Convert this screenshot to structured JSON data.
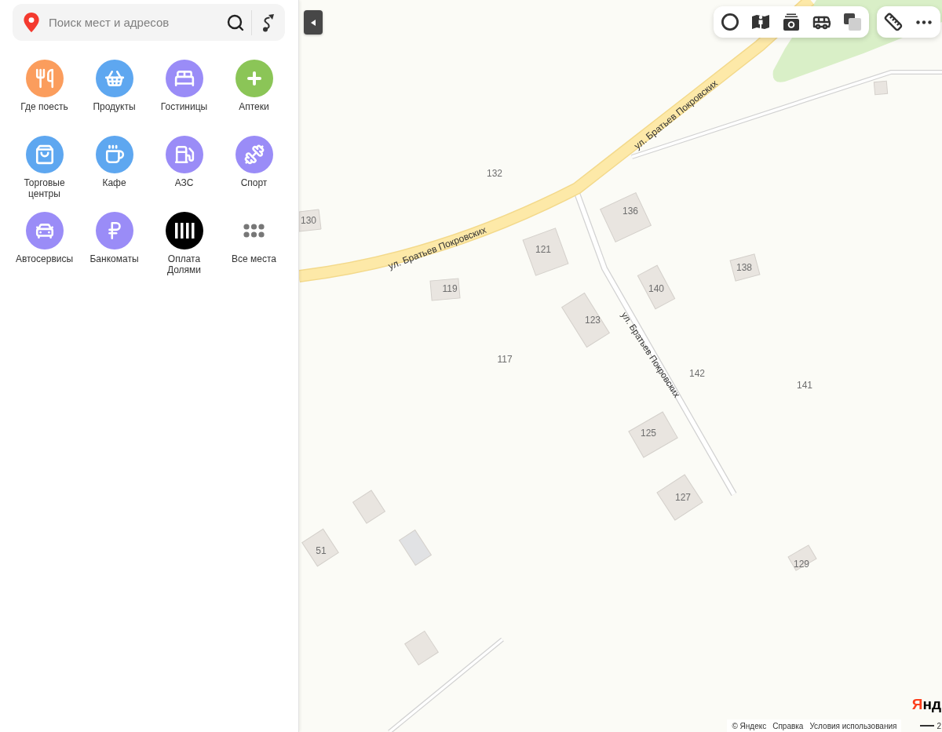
{
  "search": {
    "placeholder": "Поиск мест и адресов"
  },
  "categories": [
    {
      "label": "Где поесть",
      "kind": "category",
      "color": "#fb9d5d"
    },
    {
      "label": "Продукты",
      "kind": "category",
      "color": "#5ea7f0"
    },
    {
      "label": "Гостиницы",
      "kind": "category",
      "color": "#9a8cf7"
    },
    {
      "label": "Аптеки",
      "kind": "category",
      "color": "#8bc557"
    },
    {
      "label": "Торговые центры",
      "kind": "category",
      "color": "#5ea7f0"
    },
    {
      "label": "Кафе",
      "kind": "category",
      "color": "#5ea7f0"
    },
    {
      "label": "АЗС",
      "kind": "category",
      "color": "#9a8cf7"
    },
    {
      "label": "Спорт",
      "kind": "category",
      "color": "#9a8cf7"
    },
    {
      "label": "Автосервисы",
      "kind": "category",
      "color": "#9a8cf7"
    },
    {
      "label": "Банкоматы",
      "kind": "category",
      "color": "#9a8cf7"
    },
    {
      "label": "Оплата Долями",
      "kind": "category",
      "color": "#000000"
    },
    {
      "label": "Все места",
      "kind": "more"
    }
  ],
  "map": {
    "street_labels": [
      "ул. Братьев Покровских",
      "ул. Братьев Покровских",
      "ул. Братьев Покровских"
    ],
    "house_numbers": [
      "132",
      "136",
      "130",
      "121",
      "138",
      "119",
      "140",
      "123",
      "117",
      "142",
      "141",
      "125",
      "127",
      "51",
      "129"
    ]
  },
  "footer": {
    "copyright": "© Яндекс",
    "links": [
      "Справка",
      "Условия использования"
    ],
    "logo": "Янд",
    "scale_label": "2"
  }
}
